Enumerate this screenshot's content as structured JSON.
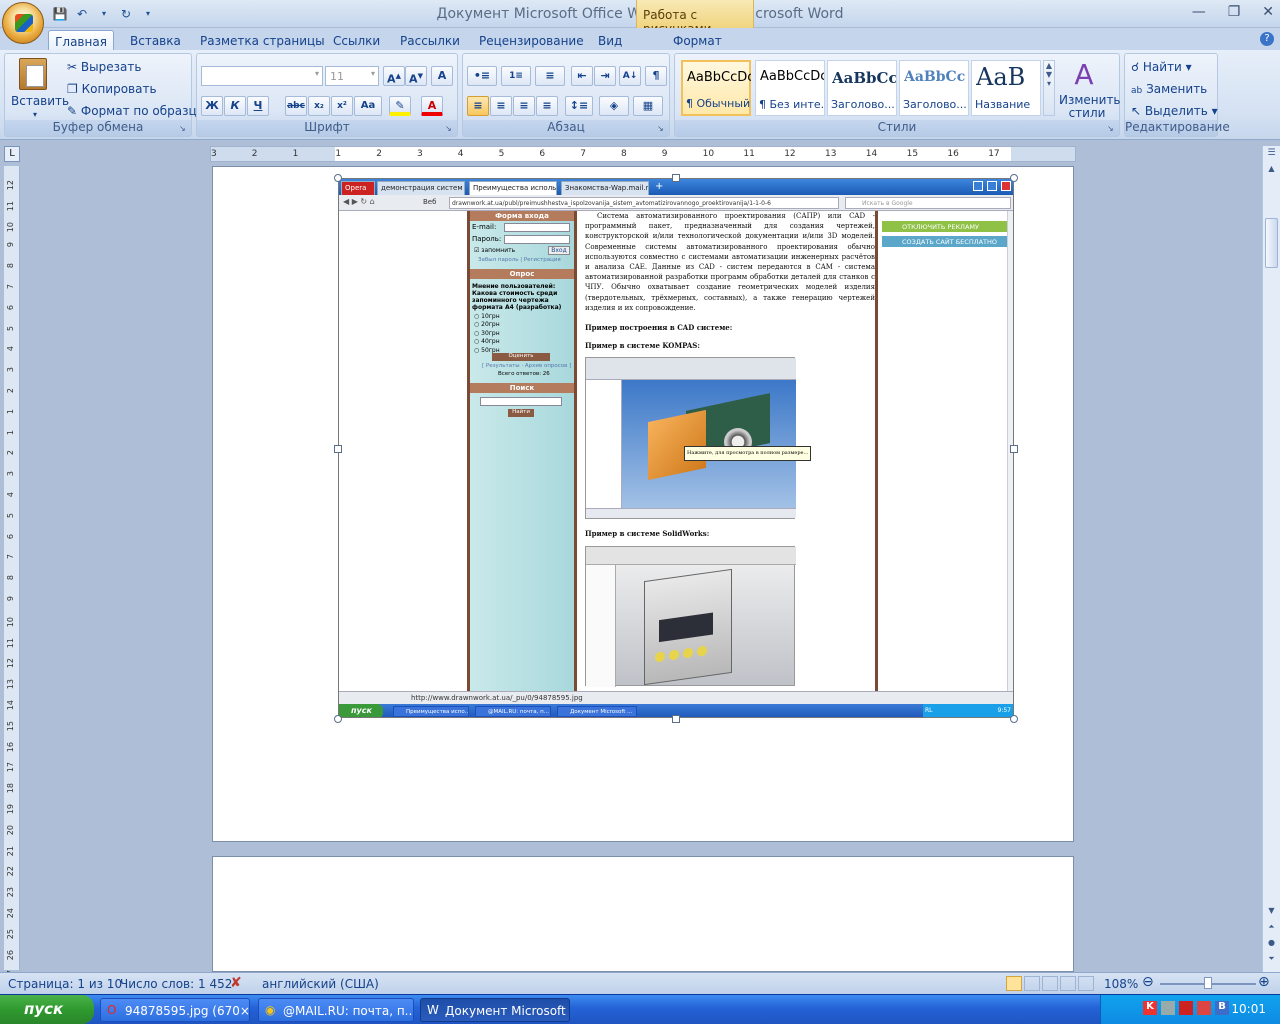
{
  "window": {
    "title": "Документ Microsoft Office Word (3).docx - Microsoft Word",
    "context_tab_header": "Работа с рисунками"
  },
  "tabs": [
    {
      "label": "Главная"
    },
    {
      "label": "Вставка"
    },
    {
      "label": "Разметка страницы"
    },
    {
      "label": "Ссылки"
    },
    {
      "label": "Рассылки"
    },
    {
      "label": "Рецензирование"
    },
    {
      "label": "Вид"
    },
    {
      "label": "Формат"
    }
  ],
  "clipboard": {
    "paste": "Вставить",
    "cut": "Вырезать",
    "copy": "Копировать",
    "format_painter": "Формат по образцу",
    "label": "Буфер обмена"
  },
  "font": {
    "size": "11",
    "label": "Шрифт"
  },
  "paragraph": {
    "label": "Абзац"
  },
  "styles": {
    "label": "Стили",
    "tiles": [
      {
        "sample": "AaBbCcDc",
        "name": "¶ Обычный"
      },
      {
        "sample": "AaBbCcDc",
        "name": "¶ Без инте..."
      },
      {
        "sample": "AaBbCc",
        "name": "Заголово..."
      },
      {
        "sample": "AaBbCc",
        "name": "Заголово..."
      },
      {
        "sample": "AaB",
        "name": "Название"
      }
    ],
    "change": "Изменить стили"
  },
  "editing": {
    "find": "Найти",
    "replace": "Заменить",
    "select": "Выделить",
    "label": "Редактирование"
  },
  "ruler": {
    "marks": [
      "3",
      "2",
      "1",
      "1",
      "2",
      "3",
      "4",
      "5",
      "6",
      "7",
      "8",
      "9",
      "10",
      "11",
      "12",
      "13",
      "14",
      "15",
      "16",
      "17"
    ],
    "vmarks": [
      "12",
      "11",
      "10",
      "9",
      "8",
      "7",
      "6",
      "5",
      "4",
      "3",
      "2",
      "1",
      "1",
      "2",
      "3",
      "4",
      "5",
      "6",
      "7",
      "8",
      "9",
      "10",
      "11",
      "12",
      "13",
      "14",
      "15",
      "16",
      "17",
      "18",
      "19",
      "20",
      "21",
      "22",
      "23",
      "24",
      "25",
      "26",
      "27"
    ]
  },
  "image": {
    "browser_tabs": [
      "Opera",
      "демонстрация систем а...",
      "Преимущества использ...",
      "Знакомства-Wap.mail.ru"
    ],
    "address": "drawnwork.at.ua/publ/preimushhestva_ispolzovanija_sistem_avtomatizirovannogo_proektirovanija/1-1-0-6",
    "search_placeholder": "Искать в Google",
    "web_label": "Веб",
    "login_head": "Форма входа",
    "email_label": "E-mail:",
    "password_label": "Пароль:",
    "remember": "запомнить",
    "login_btn": "Вход",
    "forgot": "Забыл пароль | Регистрация",
    "poll_head": "Опрос",
    "poll_question": "Мнение пользователей: Какова стоимость среди запоминного чертежа формата А4 (разработка)",
    "poll_options": [
      "10грн",
      "20грн",
      "30грн",
      "40грн",
      "50грн"
    ],
    "poll_btn": "Оценить",
    "poll_links": "[ Результаты · Архив опросов ]",
    "poll_total": "Всего ответов: 26",
    "search_head": "Поиск",
    "search_btn": "Найти",
    "article": "Система автоматизированного проектирования (САПР) или CAD - программный пакет, предназначенный для создания чертежей, конструкторской и/или технологической документации и/или 3D моделей. Современные системы автоматизированного проектирования обычно используются совместно с системами автоматизации инженерных расчётов и анализа CAE. Данные из CAD - систем передаются в CAM - система автоматизированной разработки программ обработки деталей для станков с ЧПУ. Обычно охватывает создание геометрических моделей изделия (твердотельных, трёхмерных, составных), а также генерацию чертежей изделия и их сопровождение.",
    "example_cad": "Пример построения в CAD системе:",
    "example_kompas": "Пример в системе KOMPAS:",
    "tooltip": "Нажмите, для просмотра в полном размере...",
    "example_sw": "Пример в системе SolidWorks:",
    "ad1": "ОТКЛЮЧИТЬ РЕКЛАМУ",
    "ad2": "СОЗДАТЬ САЙТ БЕСПЛАТНО",
    "status_url": "http://www.drawnwork.at.ua/_pu/0/94878595.jpg",
    "tb_start": "пуск",
    "tb_tasks": [
      "Преимущества испо...",
      "@MAIL.RU: почта, п...",
      "Документ Microsoft ..."
    ],
    "tb_lang": "RL",
    "tb_time": "9:57"
  },
  "status": {
    "page": "Страница: 1 из 10",
    "words": "Число слов: 1 452",
    "lang": "английский (США)",
    "zoom": "108%"
  },
  "taskbar": {
    "start": "пуск",
    "tasks": [
      "94878595.jpg (670×...",
      "@MAIL.RU: почта, п...",
      "Документ Microsoft ..."
    ],
    "lang": "EN",
    "time": "10:01"
  }
}
